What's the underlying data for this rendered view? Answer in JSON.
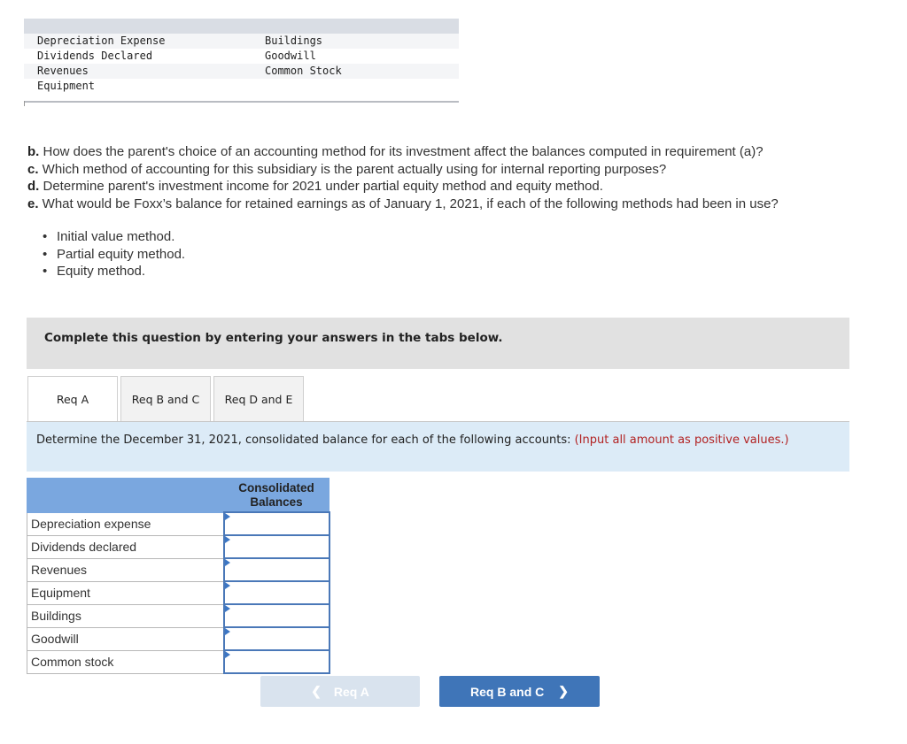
{
  "accounts_list": {
    "rows": [
      {
        "left": "Depreciation Expense",
        "right": "Buildings"
      },
      {
        "left": "Dividends Declared",
        "right": "Goodwill"
      },
      {
        "left": "Revenues",
        "right": "Common Stock"
      },
      {
        "left": "Equipment",
        "right": ""
      }
    ]
  },
  "questions": [
    {
      "letter": "b.",
      "text": " How does the parent's choice of an accounting method for its investment affect the balances computed in requirement (a)?"
    },
    {
      "letter": "c.",
      "text": " Which method of accounting for this subsidiary is the parent actually using for internal reporting purposes?"
    },
    {
      "letter": "d.",
      "text": " Determine parent's investment income for 2021 under partial equity method and equity method."
    },
    {
      "letter": "e.",
      "text": " What would be Foxx’s balance for retained earnings as of January 1, 2021, if each of the following methods had been in use?"
    }
  ],
  "methods": [
    "Initial value method.",
    "Partial equity method.",
    "Equity method."
  ],
  "banner": "Complete this question by entering your answers in the tabs below.",
  "tabs": [
    {
      "label": "Req A",
      "active": true
    },
    {
      "label": "Req B and C",
      "active": false
    },
    {
      "label": "Req D and E",
      "active": false
    }
  ],
  "instruction": {
    "text": "Determine the December 31, 2021, consolidated balance for each of the following accounts: ",
    "note": "(Input all amount as positive values.)",
    "note_color": "#b22222"
  },
  "table": {
    "header_label": "",
    "header_value": "Consolidated Balances",
    "rows": [
      {
        "label": "Depreciation expense",
        "value": ""
      },
      {
        "label": "Dividends declared",
        "value": ""
      },
      {
        "label": "Revenues",
        "value": ""
      },
      {
        "label": "Equipment",
        "value": ""
      },
      {
        "label": "Buildings",
        "value": ""
      },
      {
        "label": "Goodwill",
        "value": ""
      },
      {
        "label": "Common stock",
        "value": ""
      }
    ]
  },
  "nav": {
    "prev_label": "Req A",
    "prev_icon": "chevron-left-icon",
    "next_label": "Req B and C",
    "next_icon": "chevron-right-icon",
    "prev_disabled": true,
    "accent": "#3f75b8"
  }
}
